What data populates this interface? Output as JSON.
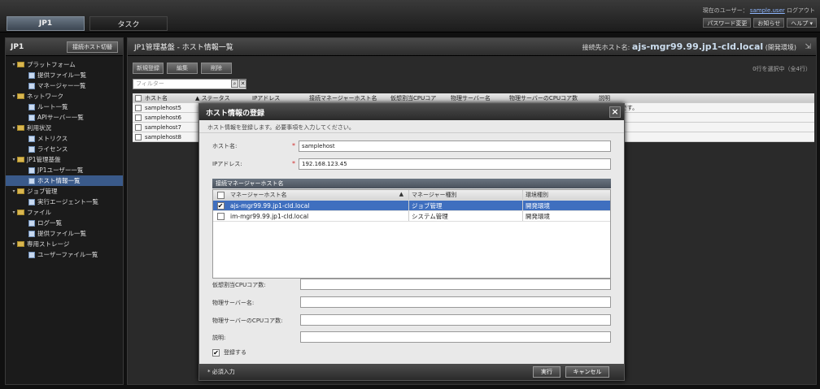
{
  "top": {
    "tabs": [
      "JP1",
      "タスク"
    ],
    "user_label": "現在のユーザー：",
    "user_name": "sample.user",
    "logout": "ログアウト",
    "buttons": [
      "パスワード変更",
      "お知らせ",
      "ヘルプ ▾"
    ]
  },
  "sidebar": {
    "title": "JP1",
    "action_button": "接続ホスト切替",
    "items": [
      {
        "label": "プラットフォーム",
        "level": 0,
        "type": "folder",
        "toggle": "▾"
      },
      {
        "label": "提供ファイル一覧",
        "level": 1,
        "type": "leaf"
      },
      {
        "label": "マネージャー一覧",
        "level": 1,
        "type": "leaf"
      },
      {
        "label": "ネットワーク",
        "level": 0,
        "type": "folder",
        "toggle": "▾"
      },
      {
        "label": "ルート一覧",
        "level": 1,
        "type": "leaf"
      },
      {
        "label": "APIサーバー一覧",
        "level": 1,
        "type": "leaf"
      },
      {
        "label": "利用状況",
        "level": 0,
        "type": "folder",
        "toggle": "▾"
      },
      {
        "label": "メトリクス",
        "level": 1,
        "type": "leaf"
      },
      {
        "label": "ライセンス",
        "level": 1,
        "type": "leaf"
      },
      {
        "label": "JP1管理基盤",
        "level": 0,
        "type": "folder",
        "toggle": "▾"
      },
      {
        "label": "JP1ユーザー一覧",
        "level": 1,
        "type": "leaf"
      },
      {
        "label": "ホスト情報一覧",
        "level": 1,
        "type": "leaf",
        "selected": true
      },
      {
        "label": "ジョブ管理",
        "level": 0,
        "type": "folder",
        "toggle": "▾"
      },
      {
        "label": "実行エージェント一覧",
        "level": 1,
        "type": "leaf"
      },
      {
        "label": "ファイル",
        "level": 0,
        "type": "folder",
        "toggle": "▾"
      },
      {
        "label": "ログ一覧",
        "level": 1,
        "type": "leaf"
      },
      {
        "label": "提供ファイル一覧",
        "level": 1,
        "type": "leaf"
      },
      {
        "label": "専用ストレージ",
        "level": 0,
        "type": "folder",
        "toggle": "▾"
      },
      {
        "label": "ユーザーファイル一覧",
        "level": 1,
        "type": "leaf"
      }
    ]
  },
  "main": {
    "title": "JP1管理基盤 - ホスト情報一覧",
    "connected_label": "接続先ホスト名:",
    "connected_host": "ajs-mgr99.99.jp1-cld.local",
    "connected_suffix": "(開発環境)",
    "toolbar": [
      "新規登録",
      "編集",
      "削除"
    ],
    "count_text": "0行を選択中（全4行）",
    "filter_placeholder": "フィルター",
    "columns": [
      "ホスト名",
      "▲ ステータス",
      "IPアドレス",
      "接続マネージャーホスト名",
      "仮想割当CPUコア",
      "物理サーバー名",
      "物理サーバーのCPUコア数",
      "説明"
    ],
    "rows": [
      {
        "host": "samplehost5",
        "desc": "サンプルです。"
      },
      {
        "host": "samplehost6",
        "desc": "-"
      },
      {
        "host": "samplehost7",
        "desc": "-"
      },
      {
        "host": "samplehost8",
        "desc": "-"
      }
    ]
  },
  "dialog": {
    "title": "ホスト情報の登録",
    "message": "ホスト情報を登録します。必要事項を入力してください。",
    "host_label": "ホスト名:",
    "host_value": "samplehost",
    "ip_label": "IPアドレス:",
    "ip_value": "192.168.123.45",
    "manager_section": "接続マネージャーホスト名",
    "table_cols": [
      "マネージャーホスト名",
      "▲",
      "マネージャー種別",
      "環境種別"
    ],
    "managers": [
      {
        "name": "ajs-mgr99.99.jp1-cld.local",
        "kind": "ジョブ管理",
        "env": "開発環境",
        "checked": true
      },
      {
        "name": "im-mgr99.99.jp1-cld.local",
        "kind": "システム管理",
        "env": "開発環境",
        "checked": false
      }
    ],
    "vcpu_label": "仮想割当CPUコア数:",
    "pserver_label": "物理サーバー名:",
    "pcpu_label": "物理サーバーのCPUコア数:",
    "desc_label": "説明:",
    "register_check": "登録する",
    "required_note": "* 必須入力",
    "ok_button": "実行",
    "cancel_button": "キャンセル"
  }
}
